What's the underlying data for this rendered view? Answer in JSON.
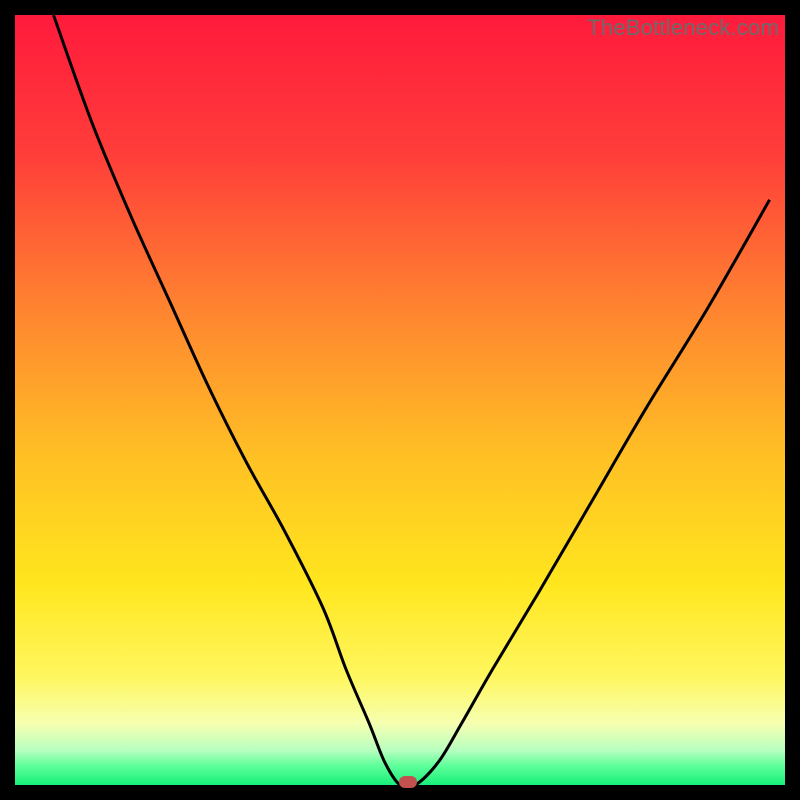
{
  "watermark": {
    "text": "TheBottleneck.com"
  },
  "colors": {
    "border": "#000000",
    "gradient_stops": [
      {
        "offset": 0.0,
        "color": "#ff1a3c"
      },
      {
        "offset": 0.18,
        "color": "#ff3d3a"
      },
      {
        "offset": 0.4,
        "color": "#ff8a2f"
      },
      {
        "offset": 0.58,
        "color": "#ffc224"
      },
      {
        "offset": 0.74,
        "color": "#ffe61e"
      },
      {
        "offset": 0.86,
        "color": "#fff760"
      },
      {
        "offset": 0.92,
        "color": "#f6ffb0"
      },
      {
        "offset": 0.955,
        "color": "#b8ffc0"
      },
      {
        "offset": 0.975,
        "color": "#5fff9a"
      },
      {
        "offset": 1.0,
        "color": "#17f07a"
      }
    ],
    "curve": "#000000",
    "marker": "#c1514e"
  },
  "chart_data": {
    "type": "line",
    "title": "",
    "xlabel": "",
    "ylabel": "",
    "xlim": [
      0,
      100
    ],
    "ylim": [
      0,
      100
    ],
    "grid": false,
    "legend": false,
    "series": [
      {
        "name": "bottleneck-curve",
        "x": [
          5,
          10,
          15,
          20,
          25,
          30,
          35,
          40,
          43,
          46,
          48,
          50,
          52,
          55,
          58,
          62,
          68,
          75,
          82,
          90,
          98
        ],
        "y": [
          100,
          86,
          74,
          63,
          52,
          42,
          33,
          23,
          15,
          8,
          3,
          0,
          0,
          3,
          8,
          15,
          25,
          37,
          49,
          62,
          76
        ]
      }
    ],
    "annotations": [
      {
        "name": "optimal-marker",
        "x": 51,
        "y": 0
      }
    ]
  }
}
